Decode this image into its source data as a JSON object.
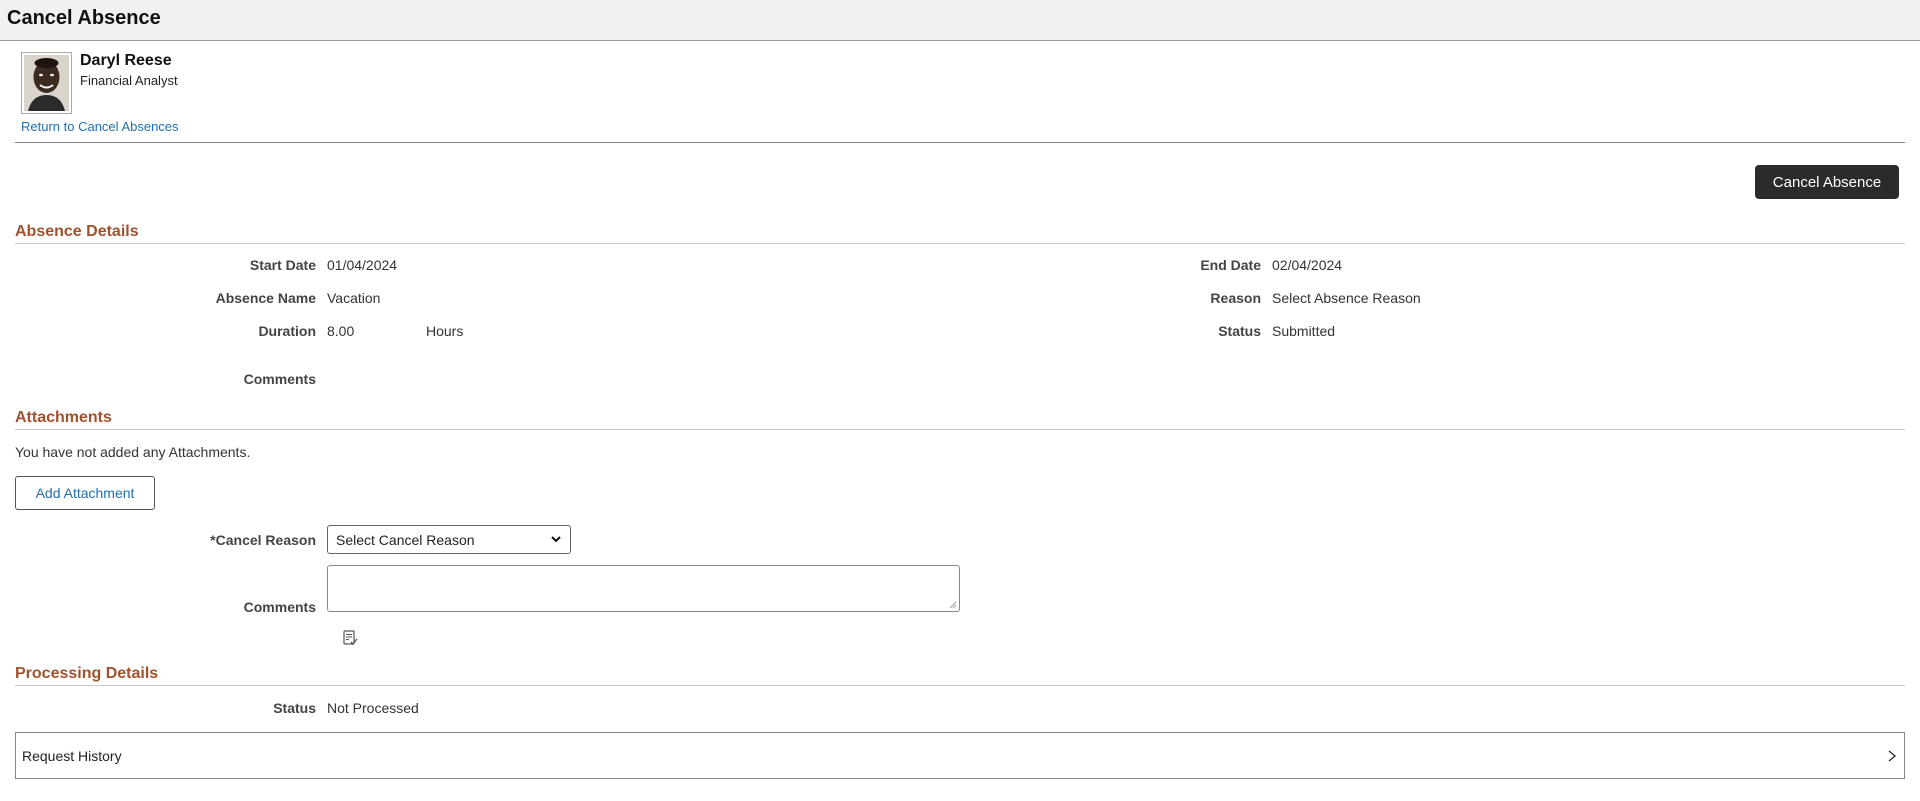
{
  "page": {
    "title": "Cancel Absence"
  },
  "employee": {
    "name": "Daryl Reese",
    "job_title": "Financial Analyst",
    "photo_icon": "employee-photo"
  },
  "nav": {
    "return_link": "Return to Cancel Absences"
  },
  "toolbar": {
    "cancel_absence_button": "Cancel Absence"
  },
  "absence_details": {
    "section_title": "Absence Details",
    "start_date_label": "Start Date",
    "start_date": "01/04/2024",
    "end_date_label": "End Date",
    "end_date": "02/04/2024",
    "absence_name_label": "Absence Name",
    "absence_name": "Vacation",
    "reason_label": "Reason",
    "reason": "Select Absence Reason",
    "duration_label": "Duration",
    "duration": "8.00",
    "duration_unit": "Hours",
    "status_label": "Status",
    "status": "Submitted",
    "comments_label": "Comments"
  },
  "attachments": {
    "section_title": "Attachments",
    "empty_message": "You have not added any Attachments.",
    "add_button": "Add Attachment"
  },
  "cancel_form": {
    "cancel_reason_label": "*Cancel Reason",
    "cancel_reason_selected": "Select Cancel Reason",
    "comments_label": "Comments",
    "comments_value": "",
    "spell_check_icon": "spell-check-icon"
  },
  "processing_details": {
    "section_title": "Processing Details",
    "status_label": "Status",
    "status": "Not Processed",
    "request_history_label": "Request History"
  },
  "colors": {
    "section_title": "#a0522d",
    "link": "#1f6fb2",
    "primary_button_bg": "#2b2b2b",
    "title_bar_bg": "#f1f1f1"
  }
}
